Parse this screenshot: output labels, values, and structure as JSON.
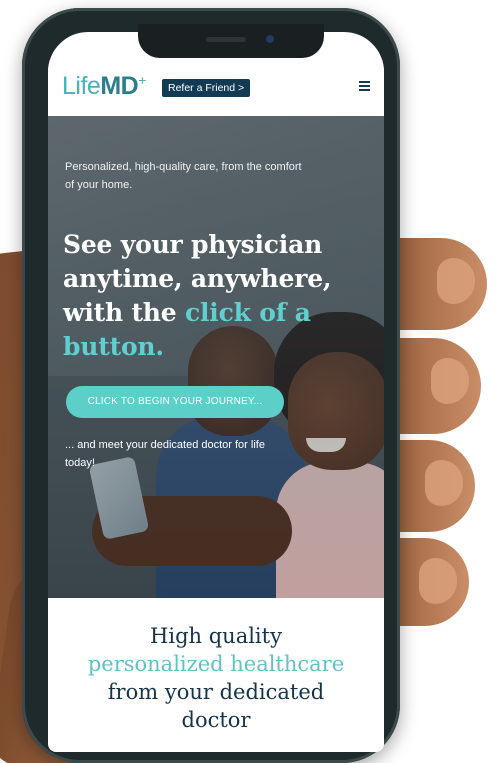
{
  "header": {
    "logo_life": "Life",
    "logo_md": "MD",
    "logo_plus": "+",
    "refer_label": "Refer a Friend >",
    "menu_icon": "hamburger-menu-icon"
  },
  "hero": {
    "subtitle": "Personalized, high-quality care, from the comfort of your home.",
    "headline_part1": "See your physician anytime, anywhere, with the ",
    "headline_accent": "click of a button.",
    "cta_label": "CLICK TO BEGIN YOUR JOURNEY...",
    "tagline": "... and meet your dedicated doctor for life today!"
  },
  "section": {
    "title_line1": "High quality",
    "title_accent": "personalized healthcare",
    "title_line3": "from your dedicated",
    "title_line4": "doctor"
  },
  "colors": {
    "accent": "#5ccfc9",
    "navy": "#153449",
    "refer_bg": "#123a52"
  }
}
